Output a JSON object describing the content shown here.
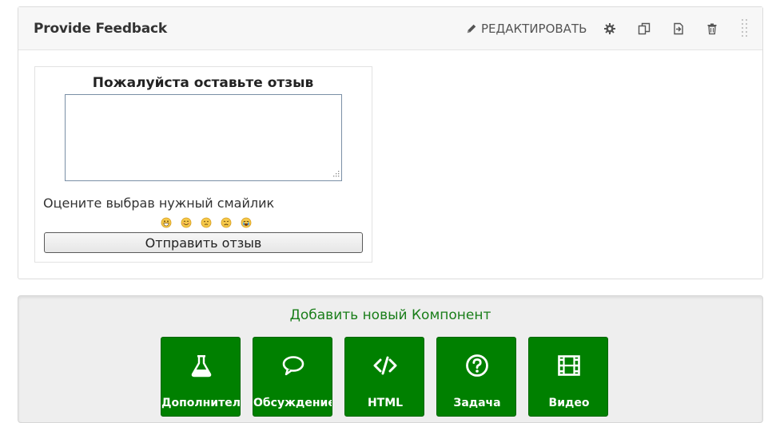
{
  "component": {
    "title": "Provide Feedback",
    "edit_label": "РЕДАКТИРОВАТЬ",
    "tools": [
      "gear-icon",
      "duplicate-icon",
      "move-icon",
      "trash-icon"
    ]
  },
  "preview": {
    "heading": "Пожалуйста оставьте отзыв",
    "textarea_value": "",
    "rate_label": "Оцените выбрав нужный смайлик",
    "smileys": [
      "grinning-icon",
      "smiling-icon",
      "neutral-icon",
      "sad-icon",
      "crying-icon"
    ],
    "submit_label": "Отправить отзыв"
  },
  "add_panel": {
    "title": "Добавить новый Компонент",
    "buttons": [
      {
        "label": "Дополнительно",
        "icon": "flask-icon"
      },
      {
        "label": "Обсуждение",
        "icon": "speech-bubble-icon"
      },
      {
        "label": "HTML",
        "icon": "code-icon"
      },
      {
        "label": "Задача",
        "icon": "question-circle-icon"
      },
      {
        "label": "Видео",
        "icon": "film-icon"
      }
    ]
  },
  "colors": {
    "green": "#008000",
    "header_bg": "#f7f7f7",
    "panel_bg": "#eeeeee",
    "title_green": "#1a7e1a"
  }
}
